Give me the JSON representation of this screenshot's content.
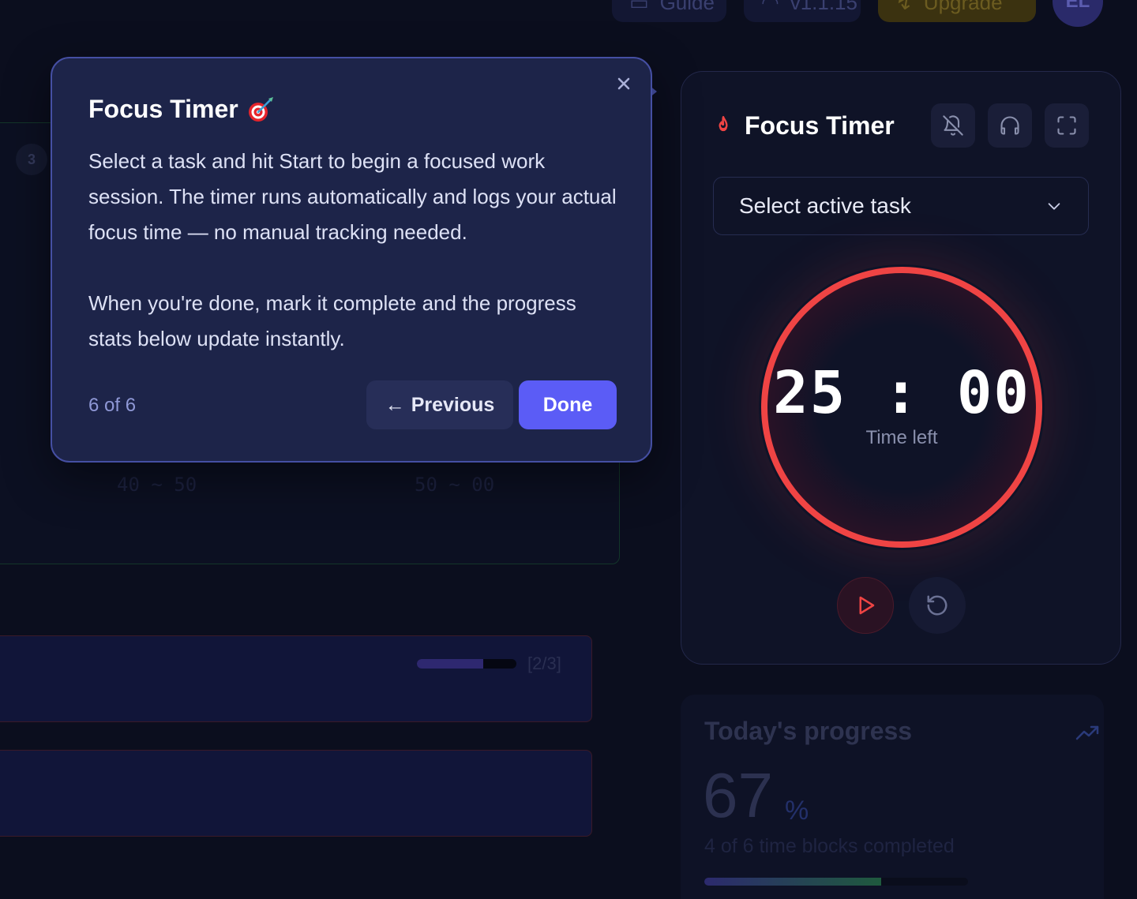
{
  "topbar": {
    "guide_label": "Guide",
    "version_label": "v1.1.15",
    "upgrade_label": "Upgrade",
    "avatar_initials": "EL"
  },
  "schedule": {
    "badge_number": "3",
    "range_labels": [
      "40 ~ 50",
      "50 ~ 00"
    ],
    "row_progress_count": "[2/3]",
    "row_progress_fraction": 0.67
  },
  "timer": {
    "title": "Focus Timer",
    "task_select_value": "Select active task",
    "time": "25:00",
    "time_label": "Time left",
    "accent_color": "#ef4444"
  },
  "progress": {
    "title": "Today's progress",
    "value": "67",
    "unit": "%",
    "subtitle": "4 of 6 time blocks completed",
    "fraction": 0.67
  },
  "tour": {
    "title": "Focus Timer",
    "paragraph_1": "Select a task and hit Start to begin a focused work session. The timer runs automatically and logs your actual focus time — no manual tracking needed.",
    "paragraph_2": "When you're done, mark it complete and the progress stats below update instantly.",
    "step": "6 of 6",
    "previous_label": "Previous",
    "previous_arrow": "←",
    "done_label": "Done"
  }
}
